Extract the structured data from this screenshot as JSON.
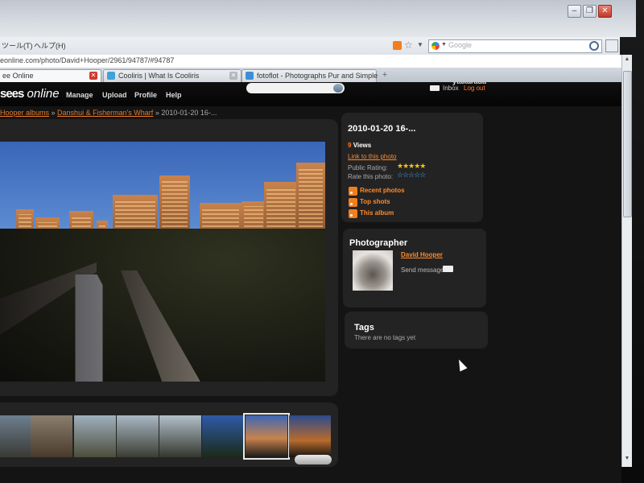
{
  "browser": {
    "menu": [
      "ツール(T)",
      "ヘルプ(H)"
    ],
    "search_placeholder": "Google",
    "url": "eonline.com/photo/David+Hooper/2961/94787/#94787",
    "tabs": [
      {
        "label": "ee Online",
        "active": true
      },
      {
        "label": "Cooliris | What Is Cooliris",
        "active": false
      },
      {
        "label": "fotoflot - Photographs Pur and Simple",
        "active": false
      }
    ],
    "new_tab": "+"
  },
  "site": {
    "logo_bold": "sees",
    "logo_italic": "online",
    "nav": [
      "Manage",
      "Upload",
      "Profile",
      "Help"
    ],
    "username": "ytakarada",
    "inbox": "Inbox",
    "logout": "Log out",
    "breadcrumb": [
      {
        "text": "Hooper albums",
        "link": true
      },
      {
        "text": " » ",
        "link": false
      },
      {
        "text": "Danshui & Fisherman's Wharf",
        "link": true
      },
      {
        "text": " » 2010-01-20 16-...",
        "link": false
      }
    ]
  },
  "info": {
    "title": "2010-01-20 16-...",
    "views_count": "9",
    "views_label": "Views",
    "link_to_photo": "Link to this photo",
    "public_rating_label": "Public Rating:",
    "rate_label": "Rate this photo:",
    "public_rating": 5,
    "feeds": [
      "Recent photos",
      "Top shots",
      "This album"
    ]
  },
  "photographer": {
    "heading": "Photographer",
    "name": "David Hooper",
    "send_message": "Send message"
  },
  "tags": {
    "heading": "Tags",
    "empty": "There are no tags yet"
  },
  "thumbnails": {
    "count": 8,
    "selected_index": 6
  }
}
